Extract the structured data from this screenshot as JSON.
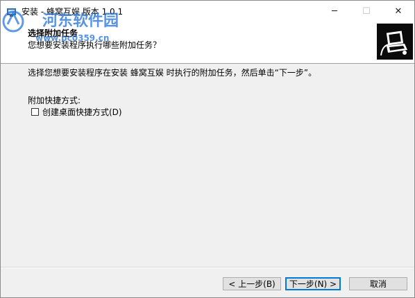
{
  "window": {
    "title": "安装 - 蜂窝互娱 版本 1.0.1",
    "minimize_glyph": "─",
    "maximize_glyph": "☐",
    "close_glyph": "✕"
  },
  "watermark": {
    "name": "河东软件园",
    "url": "www.pc0359.cn"
  },
  "header": {
    "title": "选择附加任务",
    "subtitle": "您想要安装程序执行哪些附加任务？",
    "image_icon": "computer-install-icon"
  },
  "content": {
    "instruction": "选择您想要安装程序在安装 蜂窝互娱 时执行的附加任务，然后单击“下一步”。",
    "group_label": "附加快捷方式:",
    "checkbox": {
      "label": "创建桌面快捷方式(D)",
      "checked": false
    }
  },
  "buttons": {
    "back": "< 上一步(B)",
    "next": "下一步(N) >",
    "cancel": "取消"
  },
  "colors": {
    "accent": "#0078d7",
    "watermark": "#1e6fd9"
  }
}
